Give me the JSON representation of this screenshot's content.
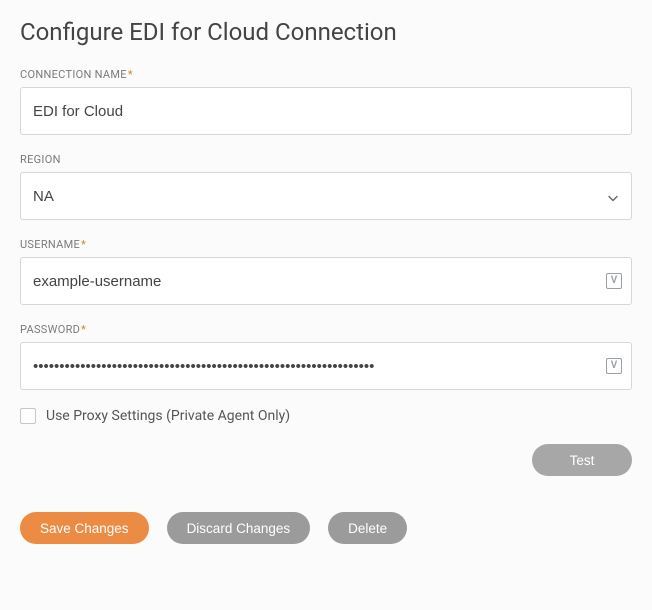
{
  "title": "Configure EDI for Cloud Connection",
  "labels": {
    "connectionName": "CONNECTION NAME",
    "region": "REGION",
    "username": "USERNAME",
    "password": "PASSWORD",
    "proxy": "Use Proxy Settings (Private Agent Only)",
    "required": "*"
  },
  "values": {
    "connectionName": "EDI for Cloud",
    "region": "NA",
    "username": "example-username",
    "password": "•••••••••••••••••••••••••••••••••••••••••••••••••••••••••••••••••"
  },
  "buttons": {
    "test": "Test",
    "save": "Save Changes",
    "discard": "Discard Changes",
    "delete": "Delete"
  },
  "icons": {
    "variable": "V"
  }
}
